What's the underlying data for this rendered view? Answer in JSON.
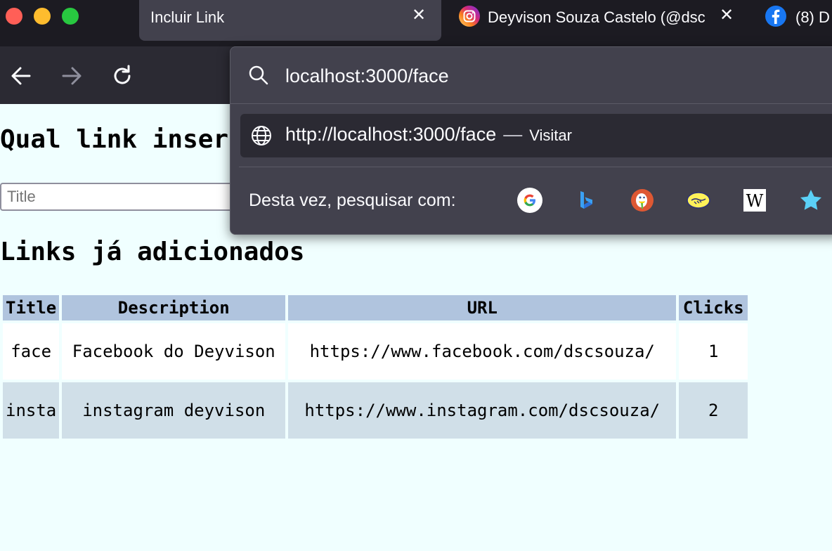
{
  "window_controls": [
    "close-window",
    "minimize-window",
    "maximize-window"
  ],
  "tabs": [
    {
      "title": "Incluir Link",
      "active": true,
      "icon": "none"
    },
    {
      "title": "Deyvison Souza Castelo (@dsc",
      "active": false,
      "icon": "instagram-icon"
    },
    {
      "title": "(8) D",
      "active": false,
      "icon": "facebook-icon"
    }
  ],
  "nav": {
    "back_icon": "back-arrow-icon",
    "forward_icon": "forward-arrow-icon",
    "reload_icon": "reload-icon"
  },
  "urlbar": {
    "value": "localhost:3000/face",
    "search_icon": "search-icon"
  },
  "suggestion": {
    "url": "http://localhost:3000/face",
    "separator": "—",
    "action": "Visitar",
    "icon": "globe-icon"
  },
  "search_with": {
    "label": "Desta vez, pesquisar com:",
    "engines": [
      "google-icon",
      "bing-icon",
      "duckduckgo-icon",
      "mercadolivre-icon",
      "wikipedia-icon",
      "bookmarks-star-icon"
    ]
  },
  "page": {
    "heading": "Qual link inserir?",
    "title_placeholder": "Title",
    "links_heading": "Links já adicionados",
    "table": {
      "headers": [
        "Title",
        "Description",
        "URL",
        "Clicks"
      ],
      "rows": [
        [
          "face",
          "Facebook do Deyvison",
          "https://www.facebook.com/dscsouza/",
          "1"
        ],
        [
          "insta",
          "instagram deyvison",
          "https://www.instagram.com/dscsouza/",
          "2"
        ]
      ]
    }
  },
  "colors": {
    "tabstrip": "#1c1b22",
    "toolbar": "#2b2a33",
    "dropdown": "#42414d",
    "page_bg": "#f0ffff",
    "table_header": "#b0c4de",
    "row_alt": "#d0dfe8"
  }
}
